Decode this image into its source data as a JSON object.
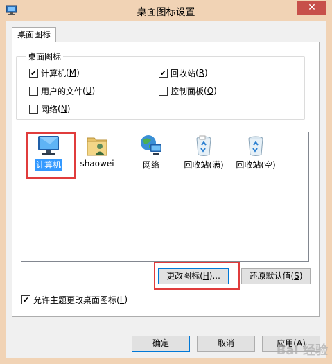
{
  "window": {
    "title": "桌面图标设置",
    "close_label": "✕"
  },
  "tabs": [
    {
      "label": "桌面图标"
    }
  ],
  "group": {
    "legend": "桌面图标",
    "checkboxes": [
      {
        "label": "计算机",
        "key": "M",
        "checked": true
      },
      {
        "label": "回收站",
        "key": "R",
        "checked": true
      },
      {
        "label": "用户的文件",
        "key": "U",
        "checked": false
      },
      {
        "label": "控制面板",
        "key": "O",
        "checked": false
      },
      {
        "label": "网络",
        "key": "N",
        "checked": false
      }
    ]
  },
  "icons": [
    {
      "label": "计算机",
      "icon": "computer-icon",
      "selected": true
    },
    {
      "label": "shaowei",
      "icon": "user-folder-icon",
      "selected": false
    },
    {
      "label": "网络",
      "icon": "network-icon",
      "selected": false
    },
    {
      "label": "回收站(满)",
      "icon": "recycle-bin-full-icon",
      "selected": false
    },
    {
      "label": "回收站(空)",
      "icon": "recycle-bin-empty-icon",
      "selected": false
    }
  ],
  "buttons": {
    "change_icon": {
      "label": "更改图标(",
      "key": "H",
      "suffix": ")..."
    },
    "restore_default": {
      "label": "还原默认值(",
      "key": "S",
      "suffix": ")"
    },
    "ok": "确定",
    "cancel": "取消",
    "apply": "应用(A)"
  },
  "allow_themes": {
    "label": "允许主题更改桌面图标(",
    "key": "L",
    "suffix": ")",
    "checked": true
  },
  "check_mark": "✔",
  "watermark": "Bai 经验"
}
